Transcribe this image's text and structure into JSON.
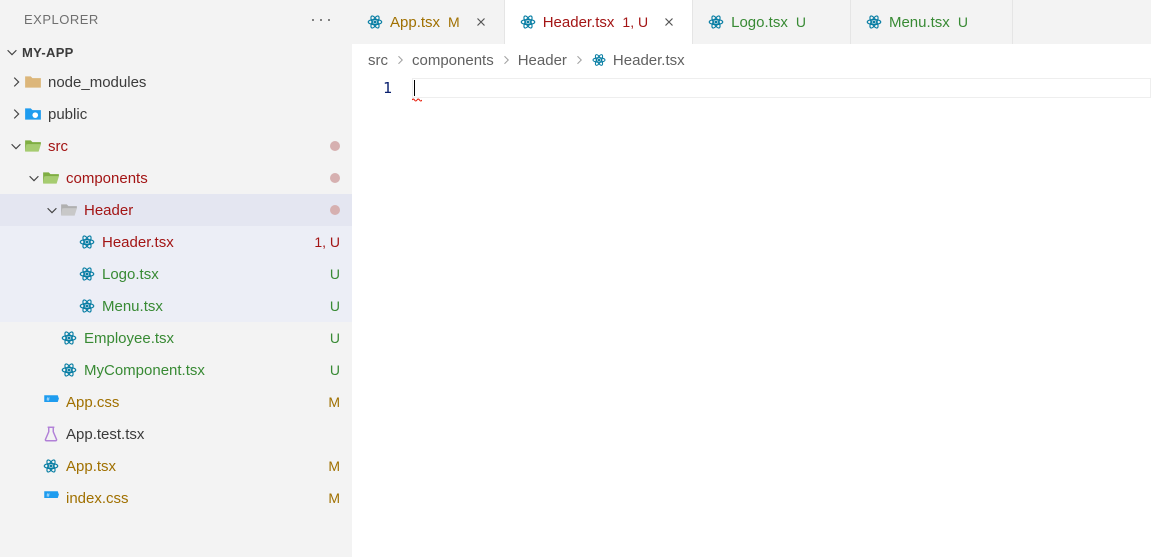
{
  "sidebar": {
    "title": "EXPLORER",
    "project": "MY-APP"
  },
  "tree": [
    {
      "label": "node_modules",
      "icon": "folder",
      "twisty": "right",
      "indent": 1,
      "color": "default"
    },
    {
      "label": "public",
      "icon": "folder-public",
      "twisty": "right",
      "indent": 1,
      "color": "default"
    },
    {
      "label": "src",
      "icon": "folder-open-green",
      "twisty": "down",
      "indent": 1,
      "color": "red",
      "dot": "#d6b0b0"
    },
    {
      "label": "components",
      "icon": "folder-open-green",
      "twisty": "down",
      "indent": 2,
      "color": "red",
      "dot": "#d6b0b0"
    },
    {
      "label": "Header",
      "icon": "folder-open",
      "twisty": "down",
      "indent": 3,
      "color": "red",
      "dot": "#d6b0b0",
      "selected": true
    },
    {
      "label": "Header.tsx",
      "icon": "react",
      "indent": 4,
      "color": "red",
      "badge": "1, U",
      "badgeColor": "red",
      "dim": true
    },
    {
      "label": "Logo.tsx",
      "icon": "react",
      "indent": 4,
      "color": "green",
      "badge": "U",
      "badgeColor": "green",
      "dim": true
    },
    {
      "label": "Menu.tsx",
      "icon": "react",
      "indent": 4,
      "color": "green",
      "badge": "U",
      "badgeColor": "green",
      "dim": true
    },
    {
      "label": "Employee.tsx",
      "icon": "react",
      "indent": 3,
      "color": "green",
      "badge": "U",
      "badgeColor": "green"
    },
    {
      "label": "MyComponent.tsx",
      "icon": "react",
      "indent": 3,
      "color": "green",
      "badge": "U",
      "badgeColor": "green"
    },
    {
      "label": "App.css",
      "icon": "css",
      "indent": 2,
      "color": "amber",
      "badge": "M",
      "badgeColor": "amber"
    },
    {
      "label": "App.test.tsx",
      "icon": "flask",
      "indent": 2,
      "color": "default"
    },
    {
      "label": "App.tsx",
      "icon": "react",
      "indent": 2,
      "color": "amber",
      "badge": "M",
      "badgeColor": "amber"
    },
    {
      "label": "index.css",
      "icon": "css",
      "indent": 2,
      "color": "amber",
      "badge": "M",
      "badgeColor": "amber"
    }
  ],
  "tabs": [
    {
      "label": "App.tsx",
      "status": "M",
      "statusColor": "amber",
      "labelColor": "amber",
      "active": false,
      "closeable": true
    },
    {
      "label": "Header.tsx",
      "status": "1, U",
      "statusColor": "red",
      "labelColor": "red",
      "active": true,
      "closeable": true
    },
    {
      "label": "Logo.tsx",
      "status": "U",
      "statusColor": "green",
      "labelColor": "green",
      "active": false,
      "closeable": false
    },
    {
      "label": "Menu.tsx",
      "status": "U",
      "statusColor": "green",
      "labelColor": "green",
      "active": false,
      "closeable": false
    }
  ],
  "breadcrumbs": [
    {
      "label": "src"
    },
    {
      "label": "components"
    },
    {
      "label": "Header"
    },
    {
      "label": "Header.tsx",
      "icon": "react"
    }
  ],
  "editor": {
    "line_numbers": [
      "1"
    ]
  }
}
